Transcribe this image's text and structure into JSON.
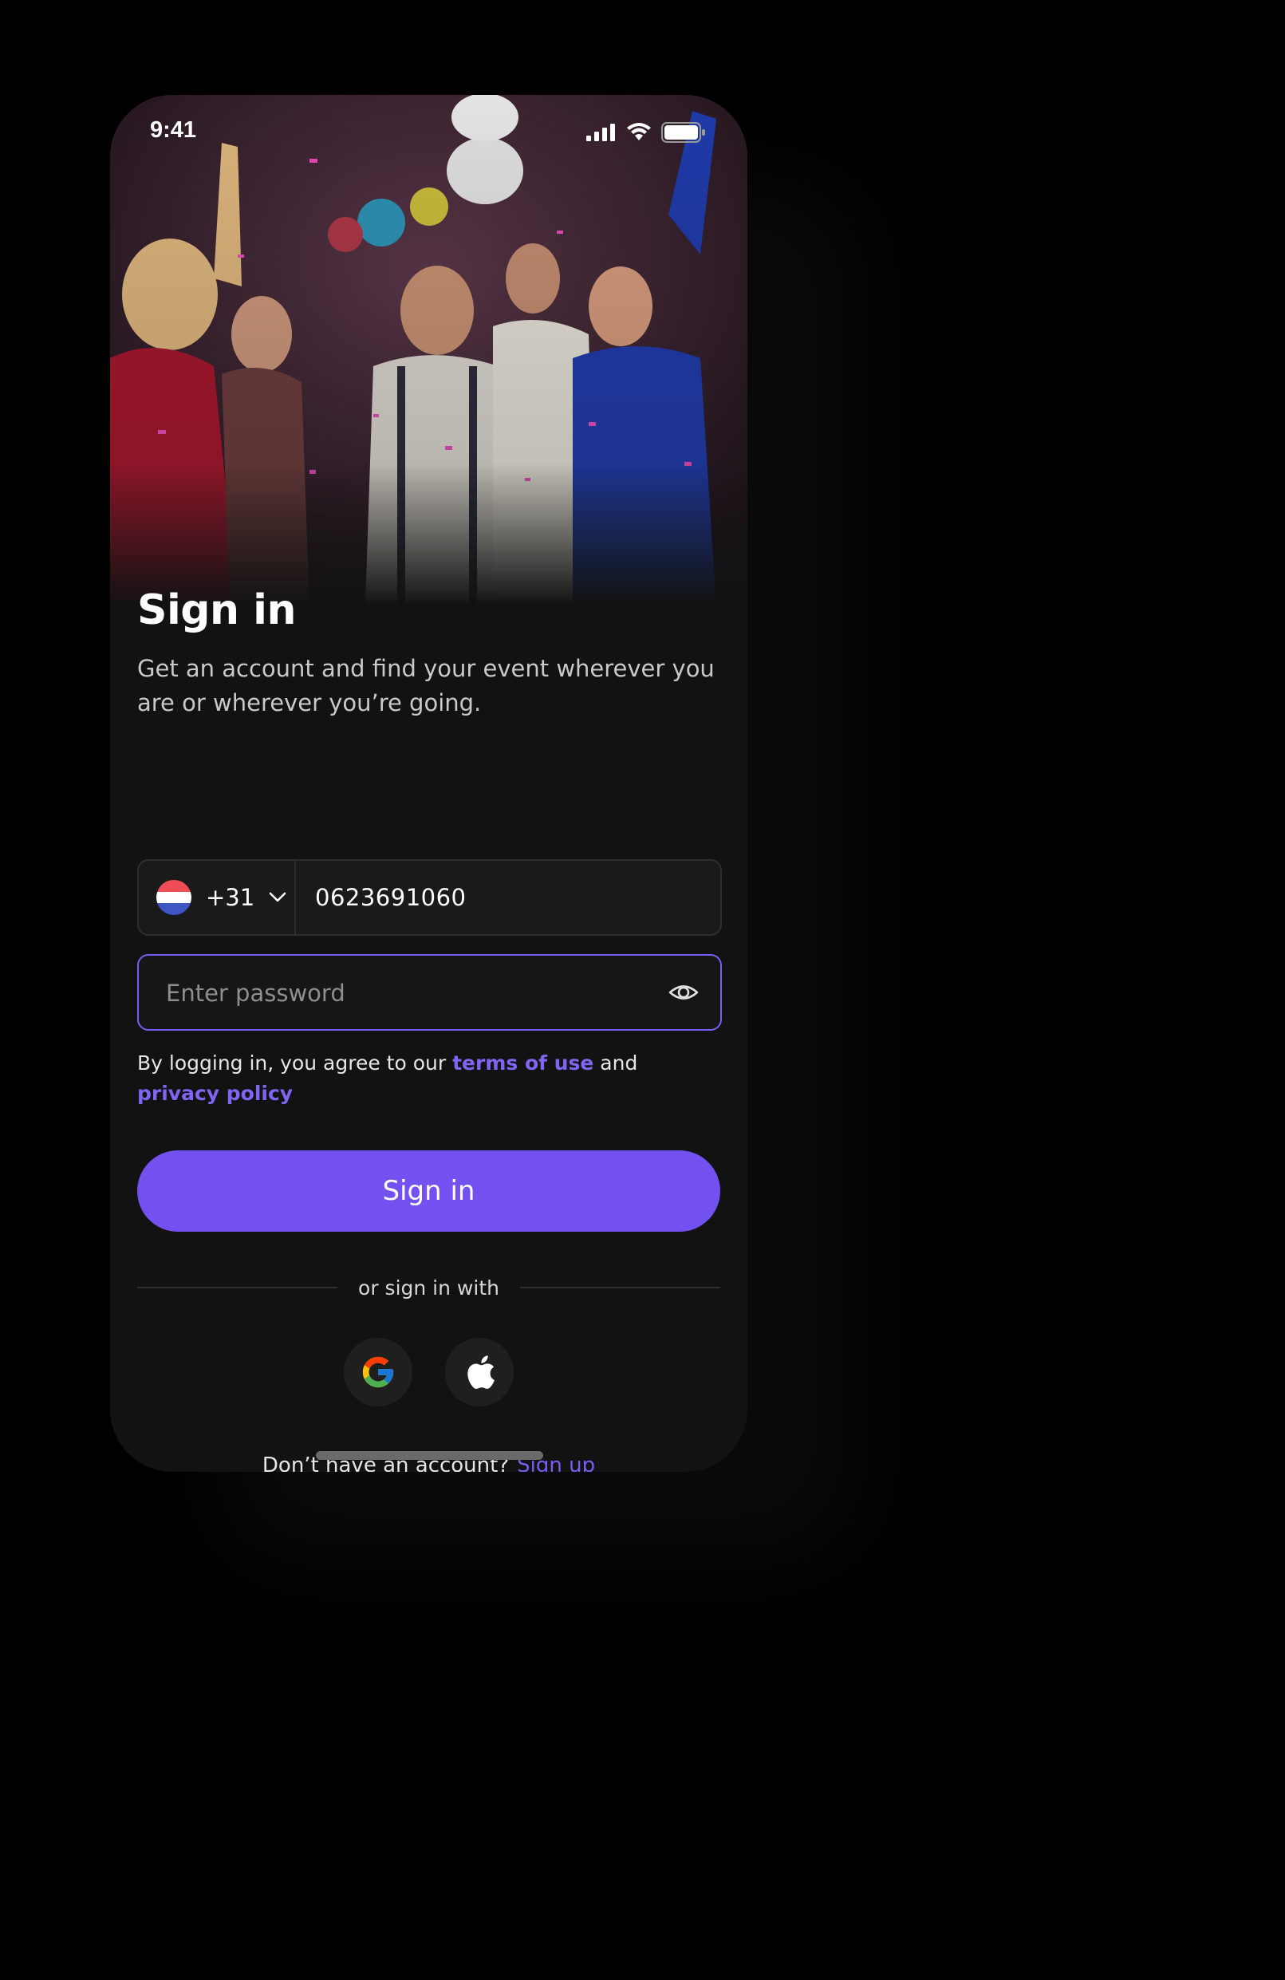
{
  "status_bar": {
    "time": "9:41",
    "icons": [
      "cellular-signal-icon",
      "wifi-icon",
      "battery-icon"
    ]
  },
  "hero": {
    "image": "party-photo"
  },
  "signin": {
    "title": "Sign in",
    "subtitle": "Get an account and find your event wherever you are or wherever you’re going.",
    "country_code": "+31",
    "country_flag": "netherlands-flag-icon",
    "phone_value": "0623691060",
    "password_placeholder": "Enter password",
    "terms_prefix": "By logging in, you agree to our ",
    "terms_link": "terms of use",
    "terms_and": " and",
    "privacy_link": "privacy policy",
    "button_label": "Sign in",
    "divider_text": "or sign in with",
    "signup_prompt": "Don’t have an account?",
    "signup_link": "Sign up"
  },
  "colors": {
    "accent": "#7350f0",
    "link": "#8065f2",
    "background": "#121212",
    "page_background": "#000000"
  }
}
